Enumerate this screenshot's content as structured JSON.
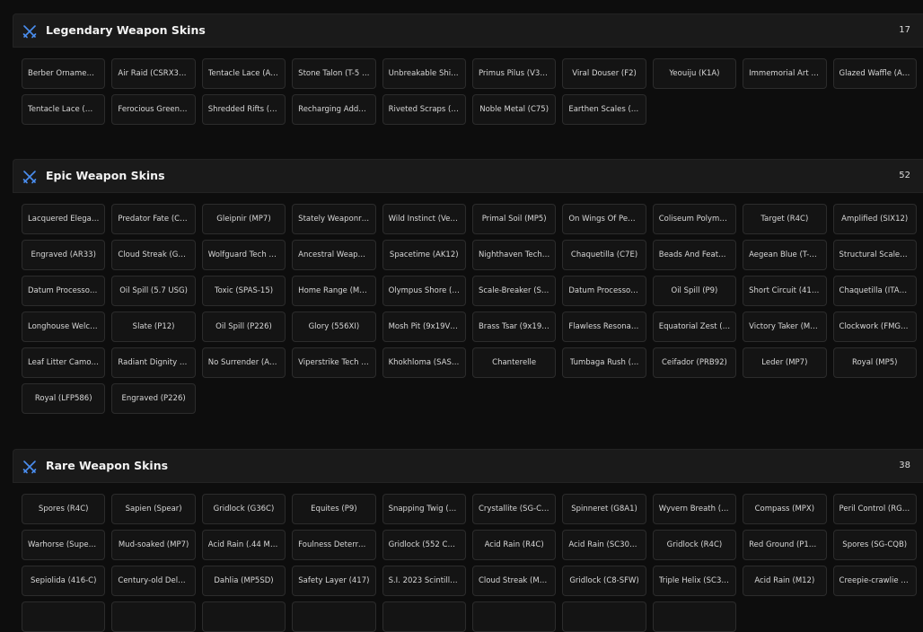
{
  "icon_color": "#4a8ef0",
  "sections": [
    {
      "title": "Legendary Weapon Skins",
      "count": "17",
      "icon": "crossed-swords-icon",
      "items": [
        "Berber Ornament…",
        "Air Raid (CSRX300)",
        "Tentacle Lace (AC…",
        "Stone Talon (T-5 S…",
        "Unbreakable Shin…",
        "Primus Pilus (V308)",
        "Viral Douser (F2)",
        "Yeouiju (K1A)",
        "Immemorial Art (…",
        "Glazed Waffle (AR…",
        "Tentacle Lace (Mx…",
        "Ferocious Green (…",
        "Shredded Rifts (F…",
        "Recharging Adder…",
        "Riveted Scraps (P…",
        "Noble Metal (C75)",
        "Earthen Scales (M…"
      ]
    },
    {
      "title": "Epic Weapon Skins",
      "count": "52",
      "icon": "crossed-swords-icon",
      "items": [
        "Lacquered Elegan…",
        "Predator Fate (CS…",
        "Gleipnir (MP7)",
        "Stately Weaponry …",
        "Wild Instinct (Vect…",
        "Primal Soil (MP5)",
        "On Wings Of Pear…",
        "Coliseum Polymer…",
        "Target (R4C)",
        "Amplified (SIX12)",
        "Engraved (AR33)",
        "Cloud Streak (G36…",
        "Wolfguard Tech (S…",
        "Ancestral Weapon…",
        "Spacetime (AK12)",
        "Nighthaven Tech (…",
        "Chaquetilla (C7E)",
        "Beads And Feathe…",
        "Aegean Blue (T-5 …",
        "Structural Scales (…",
        "Datum Processor …",
        "Oil Spill (5.7 USG)",
        "Toxic (SPAS-15)",
        "Home Range (M8…",
        "Olympus Shore (I…",
        "Scale-Breaker (SIX…",
        "Datum Processor …",
        "Oil Spill (P9)",
        "Short Circuit (416…",
        "Chaquetilla (ITA12…",
        "Longhouse Welco…",
        "Slate (P12)",
        "Oil Spill (P226)",
        "Glory (556XI)",
        "Mosh Pit (9x19VSN)",
        "Brass Tsar (9x19V…",
        "Flawless Resonan…",
        "Equatorial Zest (…",
        "Victory Taker (M2…",
        "Clockwork (FMG-9)",
        "Leaf Litter Camo (…",
        "Radiant Dignity (…",
        "No Surrender (AK…",
        "Viperstrike Tech (…",
        "Khokhloma (SASG…",
        "Chanterelle",
        "Tumbaga Rush (…",
        "Ceifador (PRB92)",
        "Leder (MP7)",
        "Royal (MP5)",
        "Royal (LFP586)",
        "Engraved (P226)"
      ]
    },
    {
      "title": "Rare Weapon Skins",
      "count": "38",
      "icon": "crossed-swords-icon",
      "items": [
        "Spores (R4C)",
        "Sapien (Spear)",
        "Gridlock (G36C)",
        "Equites (P9)",
        "Snapping Twig (A…",
        "Crystallite (SG-CQB)",
        "Spinneret (G8A1)",
        "Wyvern Breath (M…",
        "Compass (MPX)",
        "Peril Control (RG15)",
        "Warhorse (Super …",
        "Mud-soaked (MP7)",
        "Acid Rain (.44 MA…",
        "Foulness Deterren…",
        "Gridlock (552 Co…",
        "Acid Rain (R4C)",
        "Acid Rain (SC3000…",
        "Gridlock (R4C)",
        "Red Ground (P10 …",
        "Spores (SG-CQB)",
        "Sepiolida (416-C)",
        "Century-old Delus…",
        "Dahlia (MP5SD)",
        "Safety Layer (417)",
        "S.I. 2023 Scintilla (…",
        "Cloud Streak (Mk…",
        "Gridlock (C8-SFW)",
        "Triple Helix (SC30…",
        "Acid Rain (M12)",
        "Creepie-crawlie Pr…",
        "",
        "",
        "",
        "",
        "",
        "",
        "",
        ""
      ]
    }
  ]
}
